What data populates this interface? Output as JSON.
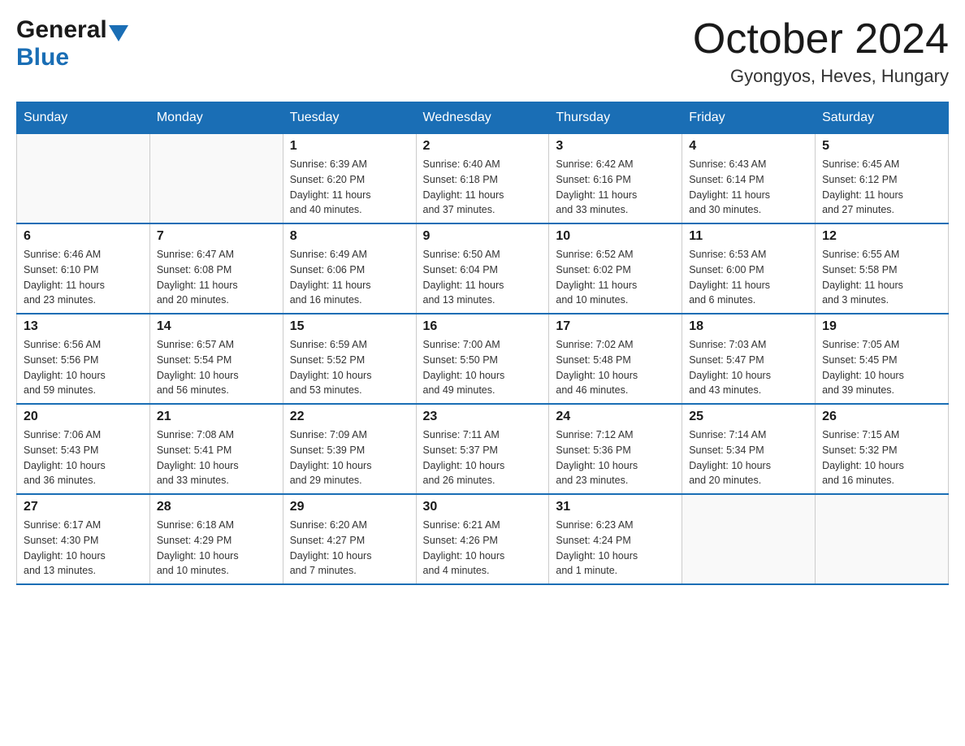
{
  "logo": {
    "general": "General",
    "blue": "Blue"
  },
  "title": "October 2024",
  "subtitle": "Gyongyos, Heves, Hungary",
  "header": {
    "days": [
      "Sunday",
      "Monday",
      "Tuesday",
      "Wednesday",
      "Thursday",
      "Friday",
      "Saturday"
    ]
  },
  "weeks": [
    [
      {
        "day": "",
        "info": ""
      },
      {
        "day": "",
        "info": ""
      },
      {
        "day": "1",
        "info": "Sunrise: 6:39 AM\nSunset: 6:20 PM\nDaylight: 11 hours\nand 40 minutes."
      },
      {
        "day": "2",
        "info": "Sunrise: 6:40 AM\nSunset: 6:18 PM\nDaylight: 11 hours\nand 37 minutes."
      },
      {
        "day": "3",
        "info": "Sunrise: 6:42 AM\nSunset: 6:16 PM\nDaylight: 11 hours\nand 33 minutes."
      },
      {
        "day": "4",
        "info": "Sunrise: 6:43 AM\nSunset: 6:14 PM\nDaylight: 11 hours\nand 30 minutes."
      },
      {
        "day": "5",
        "info": "Sunrise: 6:45 AM\nSunset: 6:12 PM\nDaylight: 11 hours\nand 27 minutes."
      }
    ],
    [
      {
        "day": "6",
        "info": "Sunrise: 6:46 AM\nSunset: 6:10 PM\nDaylight: 11 hours\nand 23 minutes."
      },
      {
        "day": "7",
        "info": "Sunrise: 6:47 AM\nSunset: 6:08 PM\nDaylight: 11 hours\nand 20 minutes."
      },
      {
        "day": "8",
        "info": "Sunrise: 6:49 AM\nSunset: 6:06 PM\nDaylight: 11 hours\nand 16 minutes."
      },
      {
        "day": "9",
        "info": "Sunrise: 6:50 AM\nSunset: 6:04 PM\nDaylight: 11 hours\nand 13 minutes."
      },
      {
        "day": "10",
        "info": "Sunrise: 6:52 AM\nSunset: 6:02 PM\nDaylight: 11 hours\nand 10 minutes."
      },
      {
        "day": "11",
        "info": "Sunrise: 6:53 AM\nSunset: 6:00 PM\nDaylight: 11 hours\nand 6 minutes."
      },
      {
        "day": "12",
        "info": "Sunrise: 6:55 AM\nSunset: 5:58 PM\nDaylight: 11 hours\nand 3 minutes."
      }
    ],
    [
      {
        "day": "13",
        "info": "Sunrise: 6:56 AM\nSunset: 5:56 PM\nDaylight: 10 hours\nand 59 minutes."
      },
      {
        "day": "14",
        "info": "Sunrise: 6:57 AM\nSunset: 5:54 PM\nDaylight: 10 hours\nand 56 minutes."
      },
      {
        "day": "15",
        "info": "Sunrise: 6:59 AM\nSunset: 5:52 PM\nDaylight: 10 hours\nand 53 minutes."
      },
      {
        "day": "16",
        "info": "Sunrise: 7:00 AM\nSunset: 5:50 PM\nDaylight: 10 hours\nand 49 minutes."
      },
      {
        "day": "17",
        "info": "Sunrise: 7:02 AM\nSunset: 5:48 PM\nDaylight: 10 hours\nand 46 minutes."
      },
      {
        "day": "18",
        "info": "Sunrise: 7:03 AM\nSunset: 5:47 PM\nDaylight: 10 hours\nand 43 minutes."
      },
      {
        "day": "19",
        "info": "Sunrise: 7:05 AM\nSunset: 5:45 PM\nDaylight: 10 hours\nand 39 minutes."
      }
    ],
    [
      {
        "day": "20",
        "info": "Sunrise: 7:06 AM\nSunset: 5:43 PM\nDaylight: 10 hours\nand 36 minutes."
      },
      {
        "day": "21",
        "info": "Sunrise: 7:08 AM\nSunset: 5:41 PM\nDaylight: 10 hours\nand 33 minutes."
      },
      {
        "day": "22",
        "info": "Sunrise: 7:09 AM\nSunset: 5:39 PM\nDaylight: 10 hours\nand 29 minutes."
      },
      {
        "day": "23",
        "info": "Sunrise: 7:11 AM\nSunset: 5:37 PM\nDaylight: 10 hours\nand 26 minutes."
      },
      {
        "day": "24",
        "info": "Sunrise: 7:12 AM\nSunset: 5:36 PM\nDaylight: 10 hours\nand 23 minutes."
      },
      {
        "day": "25",
        "info": "Sunrise: 7:14 AM\nSunset: 5:34 PM\nDaylight: 10 hours\nand 20 minutes."
      },
      {
        "day": "26",
        "info": "Sunrise: 7:15 AM\nSunset: 5:32 PM\nDaylight: 10 hours\nand 16 minutes."
      }
    ],
    [
      {
        "day": "27",
        "info": "Sunrise: 6:17 AM\nSunset: 4:30 PM\nDaylight: 10 hours\nand 13 minutes."
      },
      {
        "day": "28",
        "info": "Sunrise: 6:18 AM\nSunset: 4:29 PM\nDaylight: 10 hours\nand 10 minutes."
      },
      {
        "day": "29",
        "info": "Sunrise: 6:20 AM\nSunset: 4:27 PM\nDaylight: 10 hours\nand 7 minutes."
      },
      {
        "day": "30",
        "info": "Sunrise: 6:21 AM\nSunset: 4:26 PM\nDaylight: 10 hours\nand 4 minutes."
      },
      {
        "day": "31",
        "info": "Sunrise: 6:23 AM\nSunset: 4:24 PM\nDaylight: 10 hours\nand 1 minute."
      },
      {
        "day": "",
        "info": ""
      },
      {
        "day": "",
        "info": ""
      }
    ]
  ]
}
